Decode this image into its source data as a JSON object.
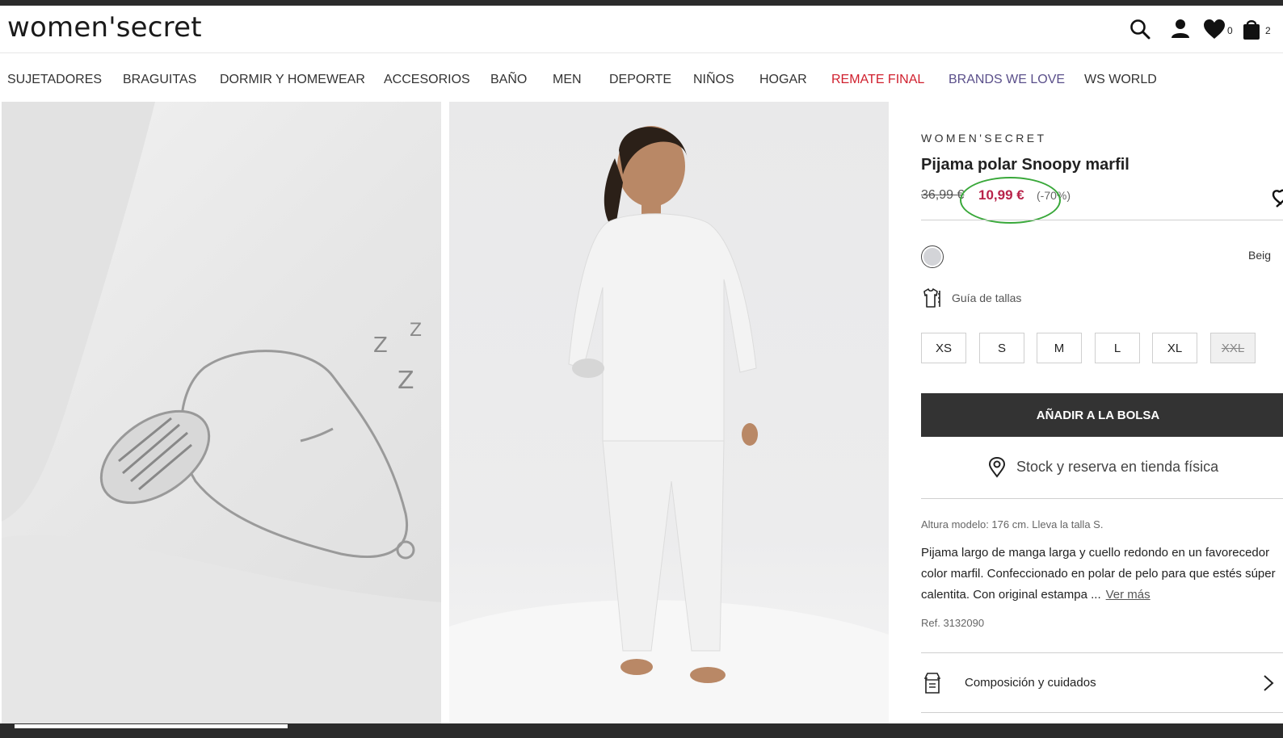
{
  "header": {
    "logo": "women'secret",
    "wishlist_count": "0",
    "cart_count": "2",
    "icons": [
      "search-icon",
      "user-icon",
      "heart-icon",
      "bag-icon"
    ]
  },
  "nav": {
    "items": [
      {
        "label": "SUJETADORES",
        "color": "#333333"
      },
      {
        "label": "BRAGUITAS",
        "color": "#333333"
      },
      {
        "label": "DORMIR Y HOMEWEAR",
        "color": "#333333"
      },
      {
        "label": "ACCESORIOS",
        "color": "#333333"
      },
      {
        "label": "BAÑO",
        "color": "#333333"
      },
      {
        "label": "MEN",
        "color": "#333333"
      },
      {
        "label": "DEPORTE",
        "color": "#333333"
      },
      {
        "label": "NIÑOS",
        "color": "#333333"
      },
      {
        "label": "HOGAR",
        "color": "#333333"
      },
      {
        "label": "REMATE FINAL",
        "color": "#d0202e"
      },
      {
        "label": "BRANDS WE LOVE",
        "color": "#5a4f8a"
      },
      {
        "label": "WS WORLD",
        "color": "#333333"
      }
    ]
  },
  "product": {
    "brand": "WOMEN'SECRET",
    "title": "Pijama polar Snoopy marfil",
    "old_price": "36,99 €",
    "new_price": "10,99 €",
    "discount": "(-70%)",
    "price_color": "#b8234a",
    "color_name": "Beig",
    "swatch_color": "#d3d4d8",
    "size_guide": "Guía de tallas",
    "sizes": [
      {
        "label": "XS",
        "available": true
      },
      {
        "label": "S",
        "available": true
      },
      {
        "label": "M",
        "available": true
      },
      {
        "label": "L",
        "available": true
      },
      {
        "label": "XL",
        "available": true
      },
      {
        "label": "XXL",
        "available": false
      }
    ],
    "add_to_bag": "AÑADIR A LA BOLSA",
    "stock_link": "Stock y reserva en tienda física",
    "model_info": "Altura modelo: 176 cm.  Lleva la talla S.",
    "description_lines": [
      "Pijama largo de manga larga y cuello redondo en un favorecedor",
      "color marfil. Confeccionado en polar de pelo para que estés súper",
      "calentita. Con original estampa ..."
    ],
    "ver_mas": "Ver más",
    "ref": "Ref. 3132090",
    "composition": "Composición y cuidados"
  },
  "annotation": {
    "color": "#39a83a"
  }
}
